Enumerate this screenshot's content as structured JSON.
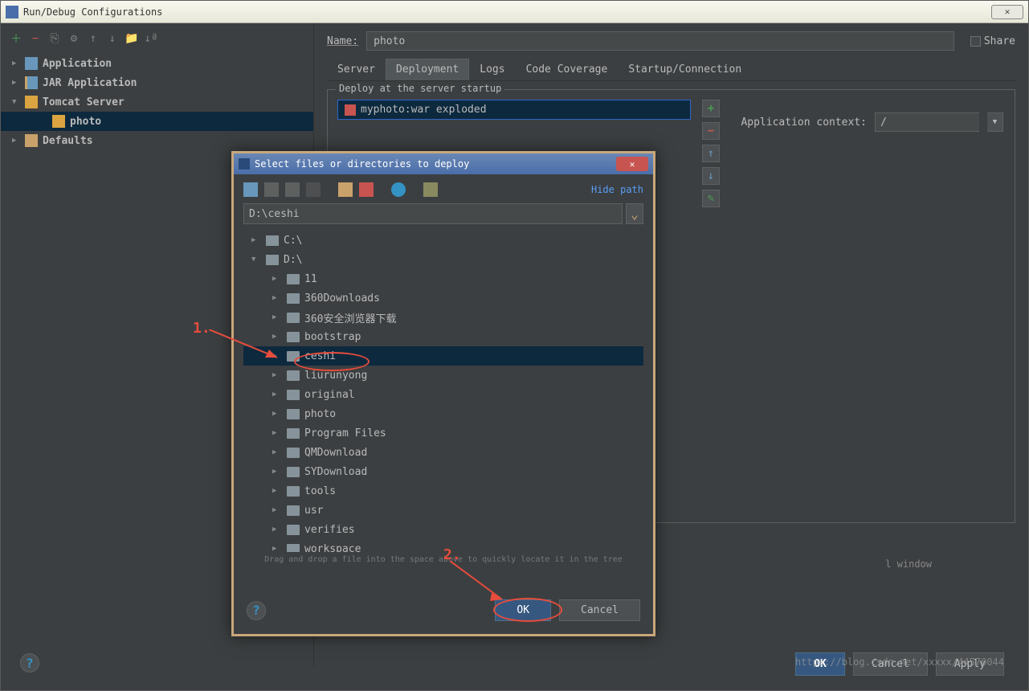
{
  "window": {
    "title": "Run/Debug Configurations",
    "close": "✕"
  },
  "sidebar_tree": [
    {
      "expand": "▶",
      "icon": "app",
      "label": "Application",
      "indent": 0
    },
    {
      "expand": "▶",
      "icon": "jar",
      "label": "JAR Application",
      "indent": 0
    },
    {
      "expand": "▼",
      "icon": "tomcat",
      "label": "Tomcat Server",
      "indent": 0
    },
    {
      "expand": "",
      "icon": "tomcat",
      "label": "photo",
      "indent": 1,
      "selected": true
    },
    {
      "expand": "▶",
      "icon": "cfg",
      "label": "Defaults",
      "indent": 0
    }
  ],
  "form": {
    "name_label": "Name:",
    "name_value": "photo",
    "share_label": "Share"
  },
  "tabs": [
    {
      "label": "Server",
      "active": false
    },
    {
      "label": "Deployment",
      "active": true
    },
    {
      "label": "Logs",
      "active": false
    },
    {
      "label": "Code Coverage",
      "active": false
    },
    {
      "label": "Startup/Connection",
      "active": false
    }
  ],
  "deploy": {
    "legend": "Deploy at the server startup",
    "artifact": "myphoto:war exploded",
    "appctx_label": "Application context:",
    "appctx_value": "/"
  },
  "side_buttons": {
    "add": "+",
    "remove": "−",
    "up": "↑",
    "down": "↓",
    "edit": "✎"
  },
  "bottom_note": "l window",
  "footer": {
    "ok": "OK",
    "cancel": "Cancel",
    "apply": "Apply"
  },
  "modal": {
    "title": "Select files or directories to deploy",
    "hide_path": "Hide path",
    "path_value": "D:\\ceshi",
    "drag_hint": "Drag and drop a file into the space above to quickly locate it in the tree",
    "ok": "OK",
    "cancel": "Cancel"
  },
  "file_tree": [
    {
      "expand": "▶",
      "type": "drive",
      "label": "C:\\",
      "indent": 0
    },
    {
      "expand": "▼",
      "type": "drive",
      "label": "D:\\",
      "indent": 0
    },
    {
      "expand": "▶",
      "type": "folder",
      "label": "11",
      "indent": 1
    },
    {
      "expand": "▶",
      "type": "folder",
      "label": "360Downloads",
      "indent": 1
    },
    {
      "expand": "▶",
      "type": "folder",
      "label": "360安全浏览器下载",
      "indent": 1
    },
    {
      "expand": "▶",
      "type": "folder",
      "label": "bootstrap",
      "indent": 1
    },
    {
      "expand": "▶",
      "type": "folder",
      "label": "ceshi",
      "indent": 1,
      "selected": true
    },
    {
      "expand": "▶",
      "type": "folder",
      "label": "liurunyong",
      "indent": 1
    },
    {
      "expand": "▶",
      "type": "folder",
      "label": "original",
      "indent": 1
    },
    {
      "expand": "▶",
      "type": "folder",
      "label": "photo",
      "indent": 1
    },
    {
      "expand": "▶",
      "type": "folder",
      "label": "Program Files",
      "indent": 1
    },
    {
      "expand": "▶",
      "type": "folder",
      "label": "QMDownload",
      "indent": 1
    },
    {
      "expand": "▶",
      "type": "folder",
      "label": "SYDownload",
      "indent": 1
    },
    {
      "expand": "▶",
      "type": "folder",
      "label": "tools",
      "indent": 1
    },
    {
      "expand": "▶",
      "type": "folder",
      "label": "usr",
      "indent": 1
    },
    {
      "expand": "▶",
      "type": "folder",
      "label": "verifies",
      "indent": 1
    },
    {
      "expand": "▶",
      "type": "folder",
      "label": "workspace",
      "indent": 1
    }
  ],
  "annotations": {
    "step1": "1.",
    "step2": "2."
  },
  "watermark": "https://blog.csdn.net/xxxxx/44570044"
}
